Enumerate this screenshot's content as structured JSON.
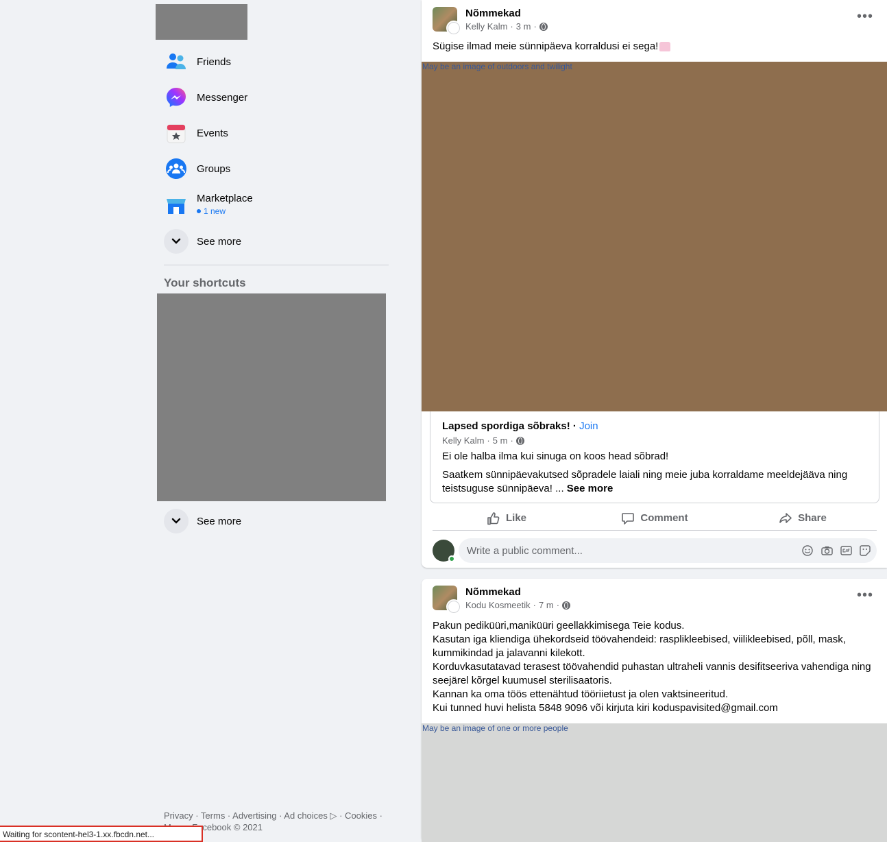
{
  "sidebar": {
    "items": [
      {
        "label": "Friends",
        "icon": "friends-icon"
      },
      {
        "label": "Messenger",
        "icon": "messenger-icon"
      },
      {
        "label": "Events",
        "icon": "events-icon"
      },
      {
        "label": "Groups",
        "icon": "groups-icon"
      },
      {
        "label": "Marketplace",
        "icon": "marketplace-icon",
        "badge": "1 new"
      }
    ],
    "see_more": "See more",
    "shortcuts_title": "Your shortcuts",
    "shortcuts_see_more": "See more"
  },
  "footer": {
    "line1": "Privacy · Terms · Advertising · Ad choices ▷ · Cookies ·",
    "line2": "More · Facebook © 2021"
  },
  "status_bar": "Waiting for scontent-hel3-1.xx.fbcdn.net...",
  "posts": [
    {
      "group": "Nõmmekad",
      "author": "Kelly Kalm",
      "time": "3 m",
      "text": "Sügise ilmad meie sünnipäeva korraldusi ei sega!",
      "image_alt": "May be an image of outdoors and twilight",
      "image_color": "#8e6e4e",
      "shared": {
        "group": "Lapsed spordiga sõbraks!",
        "join": "Join",
        "author": "Kelly Kalm",
        "time": "5 m",
        "text1": "Ei ole halba ilma kui sinuga on koos head sõbrad!",
        "text2": "Saatkem sünnipäevakutsed sõpradele laiali ning meie juba korraldame meeldejääva ning teistsuguse sünnipäeva! ...",
        "see_more": "See more"
      },
      "actions": {
        "like": "Like",
        "comment": "Comment",
        "share": "Share"
      },
      "comment_placeholder": "Write a public comment..."
    },
    {
      "group": "Nõmmekad",
      "author": "Kodu Kosmeetik",
      "time": "7 m",
      "lines": [
        "Pakun pediküüri,maniküüri geellakkimisega Teie kodus.",
        "Kasutan iga kliendiga ühekordseid töövahendeid: rasplikleebised, viilikleebised, põll, mask,",
        "kummikindad ja jalavanni kilekott.",
        "Korduvkasutatavad terasest töövahendid puhastan ultraheli vannis desifitseeriva vahendiga ning",
        "seejärel kõrgel kuumusel sterilisaatoris.",
        "Kannan ka oma töös ettenähtud tööriietust ja olen vaktsineeritud.",
        "Kui tunned huvi helista 5848 9096 või kirjuta kiri koduspavisited@gmail.com"
      ],
      "image_alt": "May be an image of one or more people",
      "image_color": "#d6d7d6"
    }
  ]
}
